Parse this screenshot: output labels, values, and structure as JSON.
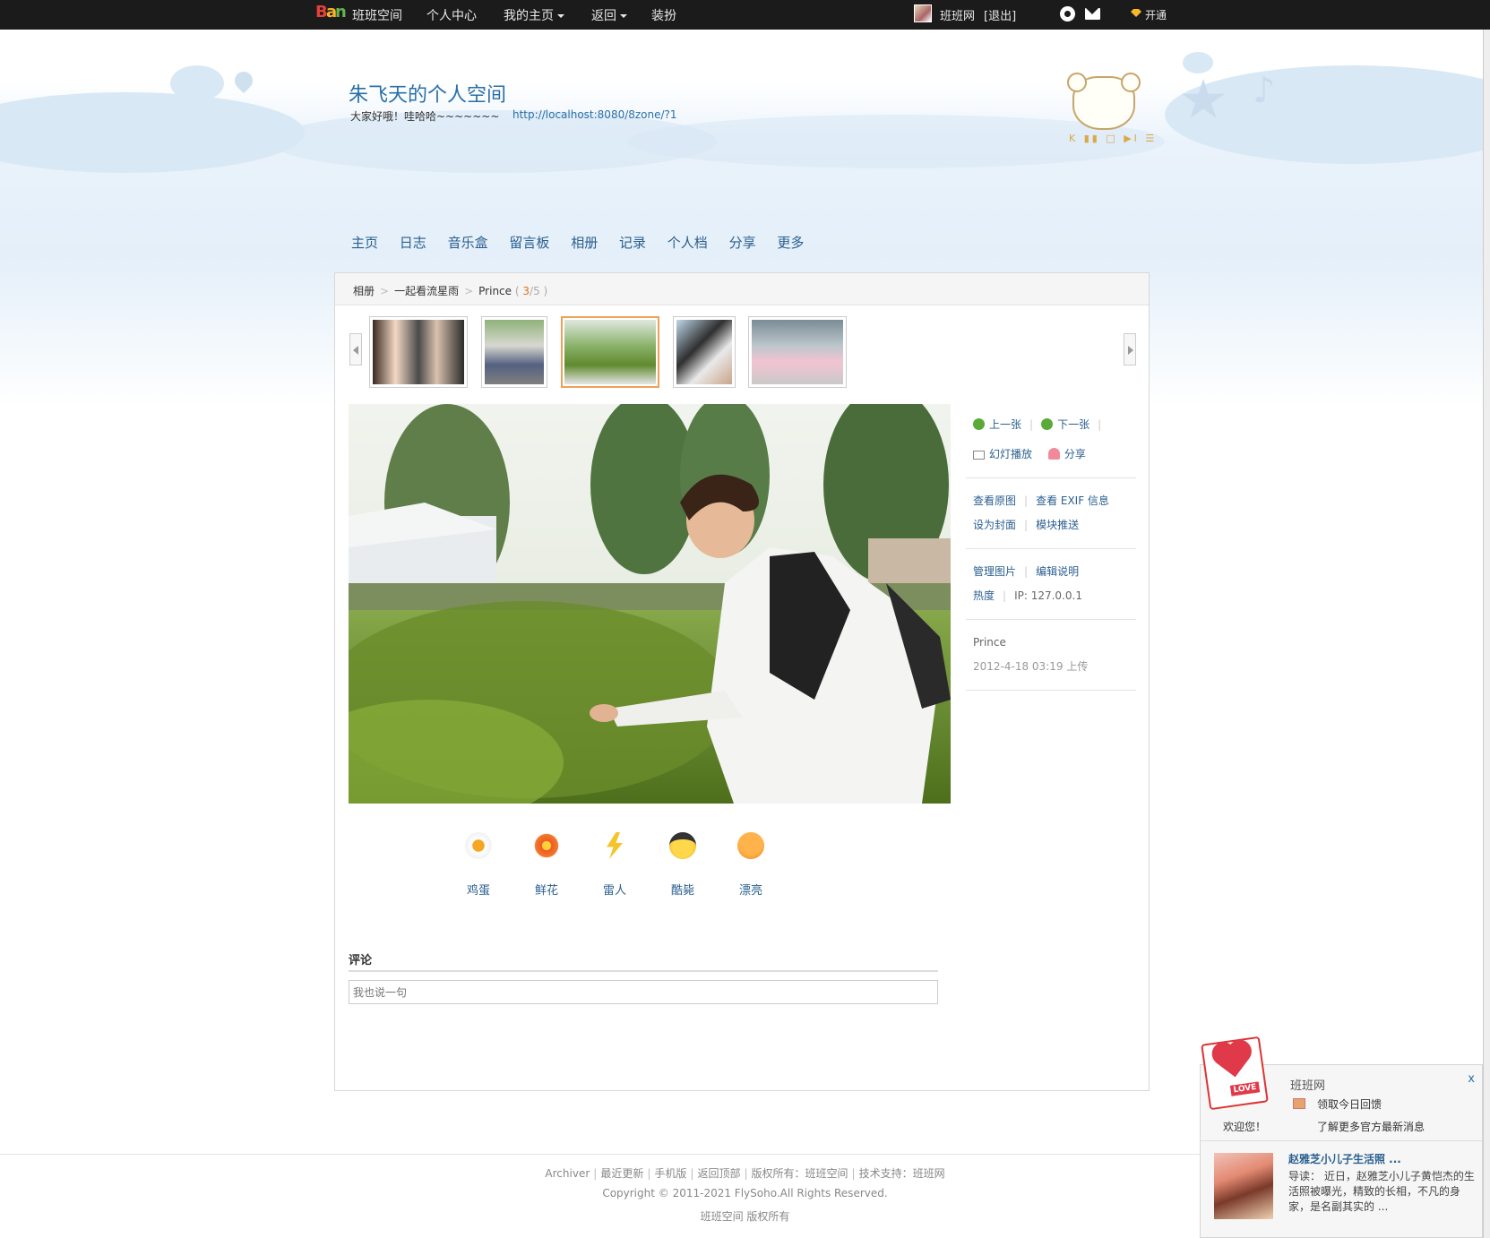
{
  "topbar": {
    "site_name": "班班空间",
    "personal_center": "个人中心",
    "my_home": "我的主页",
    "back": "返回",
    "decorate": "装扮",
    "user_site": "班班网",
    "logout": "[退出]",
    "open": "开通"
  },
  "header": {
    "title": "朱飞天的个人空间",
    "description": "大家好哦！哇哈哈~~~~~~~",
    "url": "http://localhost:8080/8zone/?1",
    "player_controls": "K ▮▮ □ ▶I ☰"
  },
  "space_nav": [
    "主页",
    "日志",
    "音乐盒",
    "留言板",
    "相册",
    "记录",
    "个人档",
    "分享",
    "更多"
  ],
  "breadcrumb": {
    "album_root": "相册",
    "album": "一起看流星雨",
    "photo": "Prince",
    "index": "3",
    "total": "5"
  },
  "thumbnails": [
    "thumb-1",
    "thumb-2",
    "thumb-3",
    "thumb-4",
    "thumb-5"
  ],
  "side": {
    "prev": "上一张",
    "next": "下一张",
    "slideshow": "幻灯播放",
    "share": "分享",
    "view_original": "查看原图",
    "view_exif": "查看 EXIF 信息",
    "set_cover": "设为封面",
    "module_push": "模块推送",
    "manage_photo": "管理图片",
    "edit_desc": "编辑说明",
    "heat": "热度",
    "ip": "IP: 127.0.0.1",
    "photo_name": "Prince",
    "upload_time": "2012-4-18 03:19 上传"
  },
  "reactions": [
    "鸡蛋",
    "鲜花",
    "雷人",
    "酷毙",
    "漂亮"
  ],
  "comment": {
    "title": "评论",
    "placeholder": "我也说一句"
  },
  "footer": {
    "links": [
      "Archiver",
      "最近更新",
      "手机版",
      "返回顶部",
      "版权所有：班班空间",
      "技术支持：班班网"
    ],
    "copyright": "Copyright © 2011-2021 FlySoho.All Rights Reserved.",
    "owner": "班班空间 版权所有"
  },
  "popup": {
    "brand": "班班网",
    "close": "x",
    "line1": "领取今日回馈",
    "welcome": "欢迎您！",
    "line2": "了解更多官方最新消息",
    "news_title": "赵雅芝小儿子生活照 ...",
    "news_body": "导读： 近日，赵雅芝小儿子黄恺杰的生活照被曝光，精致的长相，不凡的身家，是名副其实的 ...",
    "love_tag": "LOVE"
  },
  "colors": {
    "link": "#2a5f8f",
    "accent_orange": "#e0701b",
    "topbar": "#1b1b1b"
  }
}
